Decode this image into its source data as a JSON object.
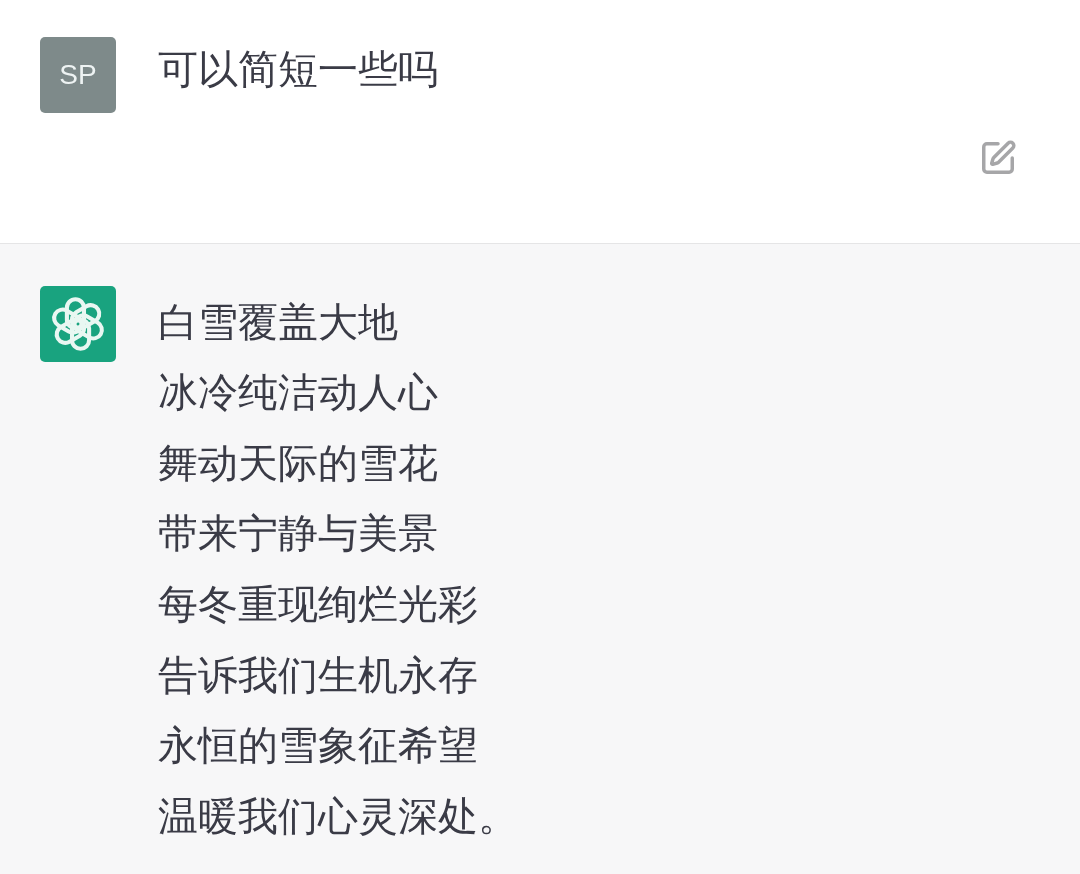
{
  "messages": [
    {
      "kind": "user",
      "avatar": "SP",
      "lines": [
        "可以简短一些吗"
      ]
    },
    {
      "kind": "assistant",
      "lines": [
        "白雪覆盖大地",
        "冰冷纯洁动人心",
        "舞动天际的雪花",
        "带来宁静与美景",
        "每冬重现绚烂光彩",
        "告诉我们生机永存",
        "永恒的雪象征希望",
        "温暖我们心灵深处。"
      ]
    }
  ]
}
